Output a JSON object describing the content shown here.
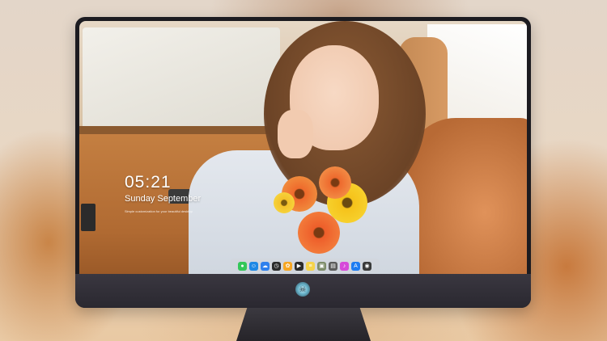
{
  "lock_screen": {
    "time": "05:21",
    "date": "Sunday September",
    "subtitle": "Simple customization for your beautiful desktop"
  },
  "dock": {
    "items": [
      {
        "name": "messages-icon",
        "glyph": "●",
        "color": "#34c759"
      },
      {
        "name": "finder-icon",
        "glyph": "☺",
        "color": "#1e88e5"
      },
      {
        "name": "weather-icon",
        "glyph": "☁",
        "color": "#2f80ed"
      },
      {
        "name": "clock-icon",
        "glyph": "◷",
        "color": "#2b2b2b"
      },
      {
        "name": "photos-icon",
        "glyph": "✿",
        "color": "#f6a623"
      },
      {
        "name": "video-icon",
        "glyph": "▶",
        "color": "#2a2a2a"
      },
      {
        "name": "notes-icon",
        "glyph": "≡",
        "color": "#f5d34a"
      },
      {
        "name": "preview-icon",
        "glyph": "▣",
        "color": "#7d8c6a"
      },
      {
        "name": "files-icon",
        "glyph": "▤",
        "color": "#5b5b5b"
      },
      {
        "name": "music-icon",
        "glyph": "♪",
        "color": "#d64ad9"
      },
      {
        "name": "app-store-icon",
        "glyph": "A",
        "color": "#1e7cf2"
      },
      {
        "name": "camera-icon",
        "glyph": "◉",
        "color": "#3a3a3a"
      }
    ]
  },
  "branding": {
    "logo": "skull-logo-icon"
  }
}
